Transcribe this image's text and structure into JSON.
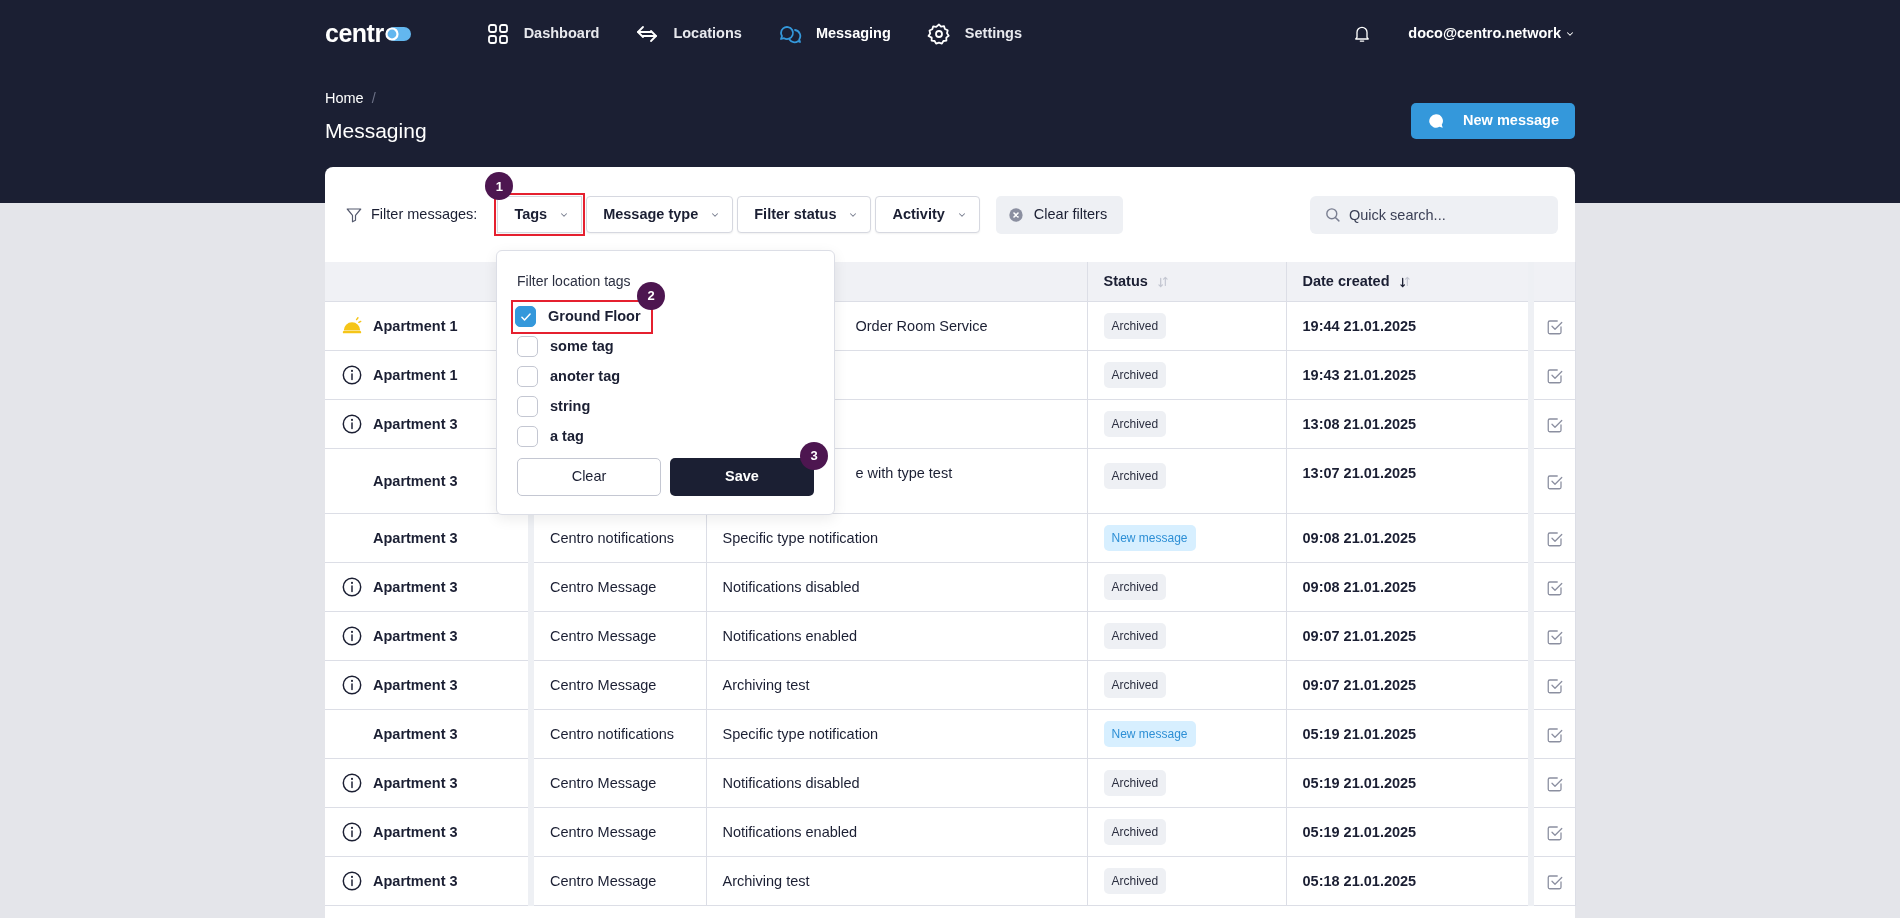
{
  "logo": {
    "text": "centr"
  },
  "nav": [
    {
      "label": "Dashboard",
      "selected": false
    },
    {
      "label": "Locations",
      "selected": false
    },
    {
      "label": "Messaging",
      "selected": true
    },
    {
      "label": "Settings",
      "selected": false
    }
  ],
  "user": {
    "email": "doco@centro.network"
  },
  "breadcrumb": [
    {
      "label": "Home",
      "separator": "/"
    }
  ],
  "page_title": "Messaging",
  "new_message_button": "New message",
  "filters": {
    "label": "Filter messages:",
    "buttons": [
      {
        "label": "Tags",
        "highlighted": true,
        "marker": "1"
      },
      {
        "label": "Message type",
        "highlighted": false
      },
      {
        "label": "Filter status",
        "highlighted": false
      },
      {
        "label": "Activity",
        "highlighted": false
      }
    ],
    "clear": "Clear filters",
    "search": {
      "placeholder": "Quick search..."
    }
  },
  "tags_dropdown": {
    "title": "Filter location tags",
    "items": [
      {
        "label": "Ground Floor",
        "checked": true,
        "highlighted": true,
        "marker": "2"
      },
      {
        "label": "some tag",
        "checked": false,
        "highlighted": false
      },
      {
        "label": "anoter tag",
        "checked": false,
        "highlighted": false
      },
      {
        "label": "string",
        "checked": false,
        "highlighted": false
      },
      {
        "label": "a tag",
        "checked": false,
        "highlighted": false
      }
    ],
    "clear_button": "Clear",
    "save_button": "Save",
    "save_marker": "3"
  },
  "table": {
    "columns": [
      {
        "label": "Status",
        "sorted": false
      },
      {
        "label": "Date created",
        "sorted": true
      }
    ],
    "rows": [
      {
        "kind": "service",
        "location": "Apartment 1",
        "message": "Order Room Service",
        "partial": true,
        "status": {
          "kind": "archived",
          "text": "Archived"
        },
        "date": "19:44 21.01.2025"
      },
      {
        "kind": "info",
        "location": "Apartment 1",
        "status": {
          "kind": "archived",
          "text": "Archived"
        },
        "date": "19:43 21.01.2025"
      },
      {
        "kind": "info",
        "location": "Apartment 3",
        "status": {
          "kind": "archived",
          "text": "Archived"
        },
        "date": "13:08 21.01.2025"
      },
      {
        "kind": "plain",
        "location": "Apartment 3",
        "message": "e with type test",
        "partial": true,
        "tall": true,
        "status": {
          "kind": "archived",
          "text": "Archived"
        },
        "date": "13:07 21.01.2025"
      },
      {
        "kind": "plain",
        "location": "Apartment 3",
        "type": "Centro notifications",
        "message": "Specific type notification",
        "partial": false,
        "status": {
          "kind": "new",
          "text": "New message"
        },
        "date": "09:08 21.01.2025"
      },
      {
        "kind": "info",
        "location": "Apartment 3",
        "type": "Centro Message",
        "message": "Notifications disabled",
        "partial": false,
        "status": {
          "kind": "archived",
          "text": "Archived"
        },
        "date": "09:08 21.01.2025"
      },
      {
        "kind": "info",
        "location": "Apartment 3",
        "type": "Centro Message",
        "message": "Notifications enabled",
        "partial": false,
        "status": {
          "kind": "archived",
          "text": "Archived"
        },
        "date": "09:07 21.01.2025"
      },
      {
        "kind": "info",
        "location": "Apartment 3",
        "type": "Centro Message",
        "message": "Archiving test",
        "partial": false,
        "status": {
          "kind": "archived",
          "text": "Archived"
        },
        "date": "09:07 21.01.2025"
      },
      {
        "kind": "plain",
        "location": "Apartment 3",
        "type": "Centro notifications",
        "message": "Specific type notification",
        "partial": false,
        "status": {
          "kind": "new",
          "text": "New message"
        },
        "date": "05:19 21.01.2025"
      },
      {
        "kind": "info",
        "location": "Apartment 3",
        "type": "Centro Message",
        "message": "Notifications disabled",
        "partial": false,
        "status": {
          "kind": "archived",
          "text": "Archived"
        },
        "date": "05:19 21.01.2025"
      },
      {
        "kind": "info",
        "location": "Apartment 3",
        "type": "Centro Message",
        "message": "Notifications enabled",
        "partial": false,
        "status": {
          "kind": "archived",
          "text": "Archived"
        },
        "date": "05:19 21.01.2025"
      },
      {
        "kind": "info",
        "location": "Apartment 3",
        "type": "Centro Message",
        "message": "Archiving test",
        "partial": false,
        "status": {
          "kind": "archived",
          "text": "Archived"
        },
        "date": "05:18 21.01.2025"
      }
    ]
  }
}
